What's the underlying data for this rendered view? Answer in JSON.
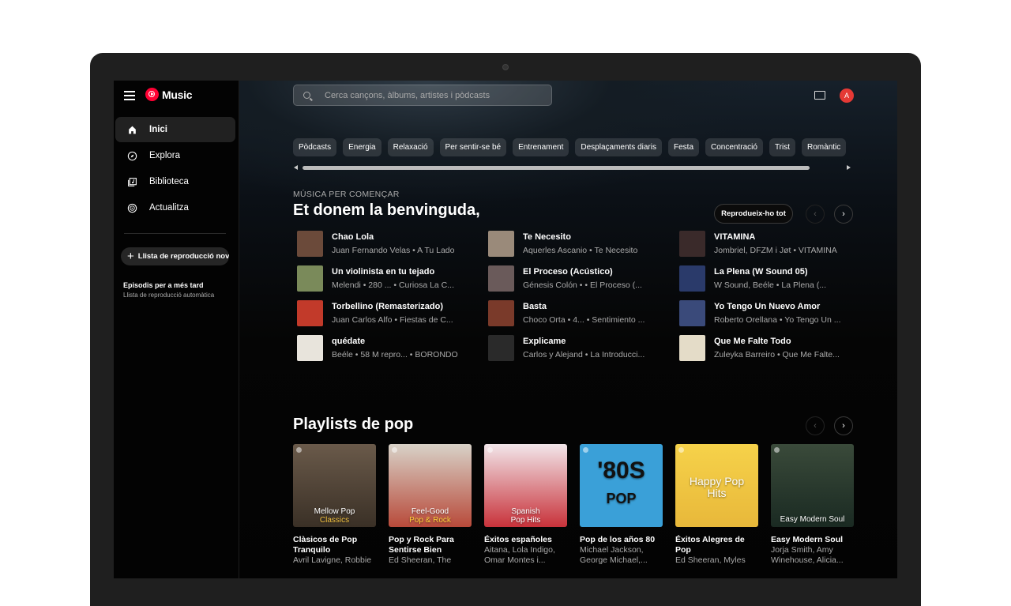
{
  "app": {
    "logo_text": "Music"
  },
  "sidebar": {
    "items": [
      {
        "label": "Inici",
        "icon": "home-icon",
        "active": true
      },
      {
        "label": "Explora",
        "icon": "compass-icon",
        "active": false
      },
      {
        "label": "Biblioteca",
        "icon": "library-icon",
        "active": false
      },
      {
        "label": "Actualitza",
        "icon": "upgrade-icon",
        "active": false
      }
    ],
    "new_playlist_label": "Llista de reproducció nova",
    "saved": {
      "title": "Episodis per a més tard",
      "subtitle": "Llista de reproducció automàtica"
    }
  },
  "header": {
    "search_placeholder": "Cerca cançons, àlbums, artistes i pòdcasts",
    "avatar_letter": "A"
  },
  "chips": [
    "Pòdcasts",
    "Energia",
    "Relaxació",
    "Per sentir-se bé",
    "Entrenament",
    "Desplaçaments diaris",
    "Festa",
    "Concentració",
    "Trist",
    "Romàntic"
  ],
  "quick_picks": {
    "subtitle": "MÚSICA PER COMENÇAR",
    "title": "Et donem la benvinguda,",
    "play_all": "Reprodueix-ho tot",
    "items": [
      {
        "title": "Chao Lola",
        "subtitle": "Juan Fernando Velas • A Tu Lado"
      },
      {
        "title": "Un violinista en tu tejado",
        "subtitle": "Melendi • 280 ... • Curiosa La C..."
      },
      {
        "title": "Torbellino (Remasterizado)",
        "subtitle": "Juan Carlos Alfo • Fiestas de C..."
      },
      {
        "title": "quédate",
        "subtitle": "Beéle • 58 M repro... • BORONDO"
      },
      {
        "title": "Te Necesito",
        "subtitle": "Aquerles Ascanio • Te Necesito"
      },
      {
        "title": "El Proceso (Acústico)",
        "subtitle": "Génesis Colón • • El Proceso (..."
      },
      {
        "title": "Basta",
        "subtitle": "Choco Orta • 4... • Sentimiento ..."
      },
      {
        "title": "Explicame",
        "subtitle": "Carlos y Alejand • La Introducci..."
      },
      {
        "title": "VITAMINA",
        "subtitle": "Jombriel, DFZM i Jøt • VITAMINA"
      },
      {
        "title": "La Plena (W Sound 05)",
        "subtitle": "W Sound, Beéle • La Plena (..."
      },
      {
        "title": "Yo Tengo Un Nuevo Amor",
        "subtitle": "Roberto Orellana • Yo Tengo Un ..."
      },
      {
        "title": "Que Me Falte Todo",
        "subtitle": "Zuleyka Barreiro • Que Me Falte..."
      }
    ],
    "thumb_colors": [
      "#6b4a3a",
      "#7a8a5a",
      "#c23a2a",
      "#e8e4dc",
      "#9a8a7a",
      "#6a5a5a",
      "#7a3a2a",
      "#2a2a2a",
      "#3a2a2a",
      "#2a3a6a",
      "#3a4a7a",
      "#e4dcc8"
    ]
  },
  "pop": {
    "title": "Playlists de pop",
    "cards": [
      {
        "art_line1": "Mellow Pop",
        "art_line2": "Classics",
        "title": "Clàsicos de Pop Tranquilo",
        "subtitle": "Avril Lavigne, Robbie"
      },
      {
        "art_line1": "Feel-Good",
        "art_line2": "Pop & Rock",
        "title": "Pop y Rock Para Sentirse Bien",
        "subtitle": "Ed Sheeran, The"
      },
      {
        "art_line1": "Spanish",
        "art_line2": "Pop Hits",
        "title": "Éxitos españoles",
        "subtitle": "Aitana, Lola Indigo, Omar Montes i..."
      },
      {
        "art_line1": "'80S",
        "art_line2": "POP",
        "title": "Pop de los años 80",
        "subtitle": "Michael Jackson, George Michael,..."
      },
      {
        "art_line1": "Happy Pop",
        "art_line2": "Hits",
        "title": "Éxitos Alegres de Pop",
        "subtitle": "Ed Sheeran, Myles"
      },
      {
        "art_line1": "Easy Modern Soul",
        "art_line2": "",
        "title": "Easy Modern Soul",
        "subtitle": "Jorja Smith, Amy Winehouse, Alicia..."
      }
    ]
  }
}
